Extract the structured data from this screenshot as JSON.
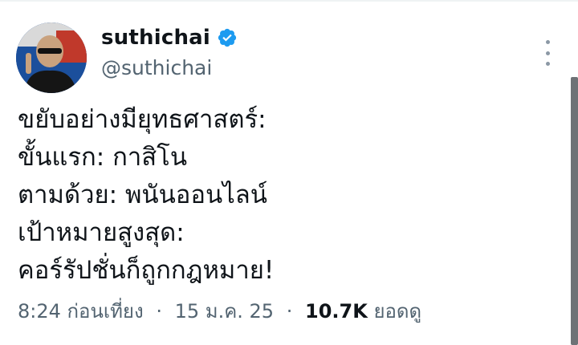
{
  "author": {
    "display_name": "suthichai",
    "handle": "@suthichai",
    "verified": true,
    "avatar_icon": "profile-photo"
  },
  "tweet": {
    "lines": [
      "ขยับอย่างมียุทธศาสตร์:",
      "ขั้นแรก: กาสิโน",
      "ตามด้วย: พนันออนไลน์",
      "เป้าหมายสูงสุด:",
      "คอร์รัปชั่นก็ถูกกฎหมาย!"
    ]
  },
  "meta": {
    "time": "8:24 ก่อนเที่ยง",
    "separator": "·",
    "date": "15 ม.ค. 25",
    "views_count": "10.7K",
    "views_label": "ยอดดู"
  },
  "colors": {
    "verified_blue": "#1d9bf0",
    "secondary_text": "#536471"
  }
}
